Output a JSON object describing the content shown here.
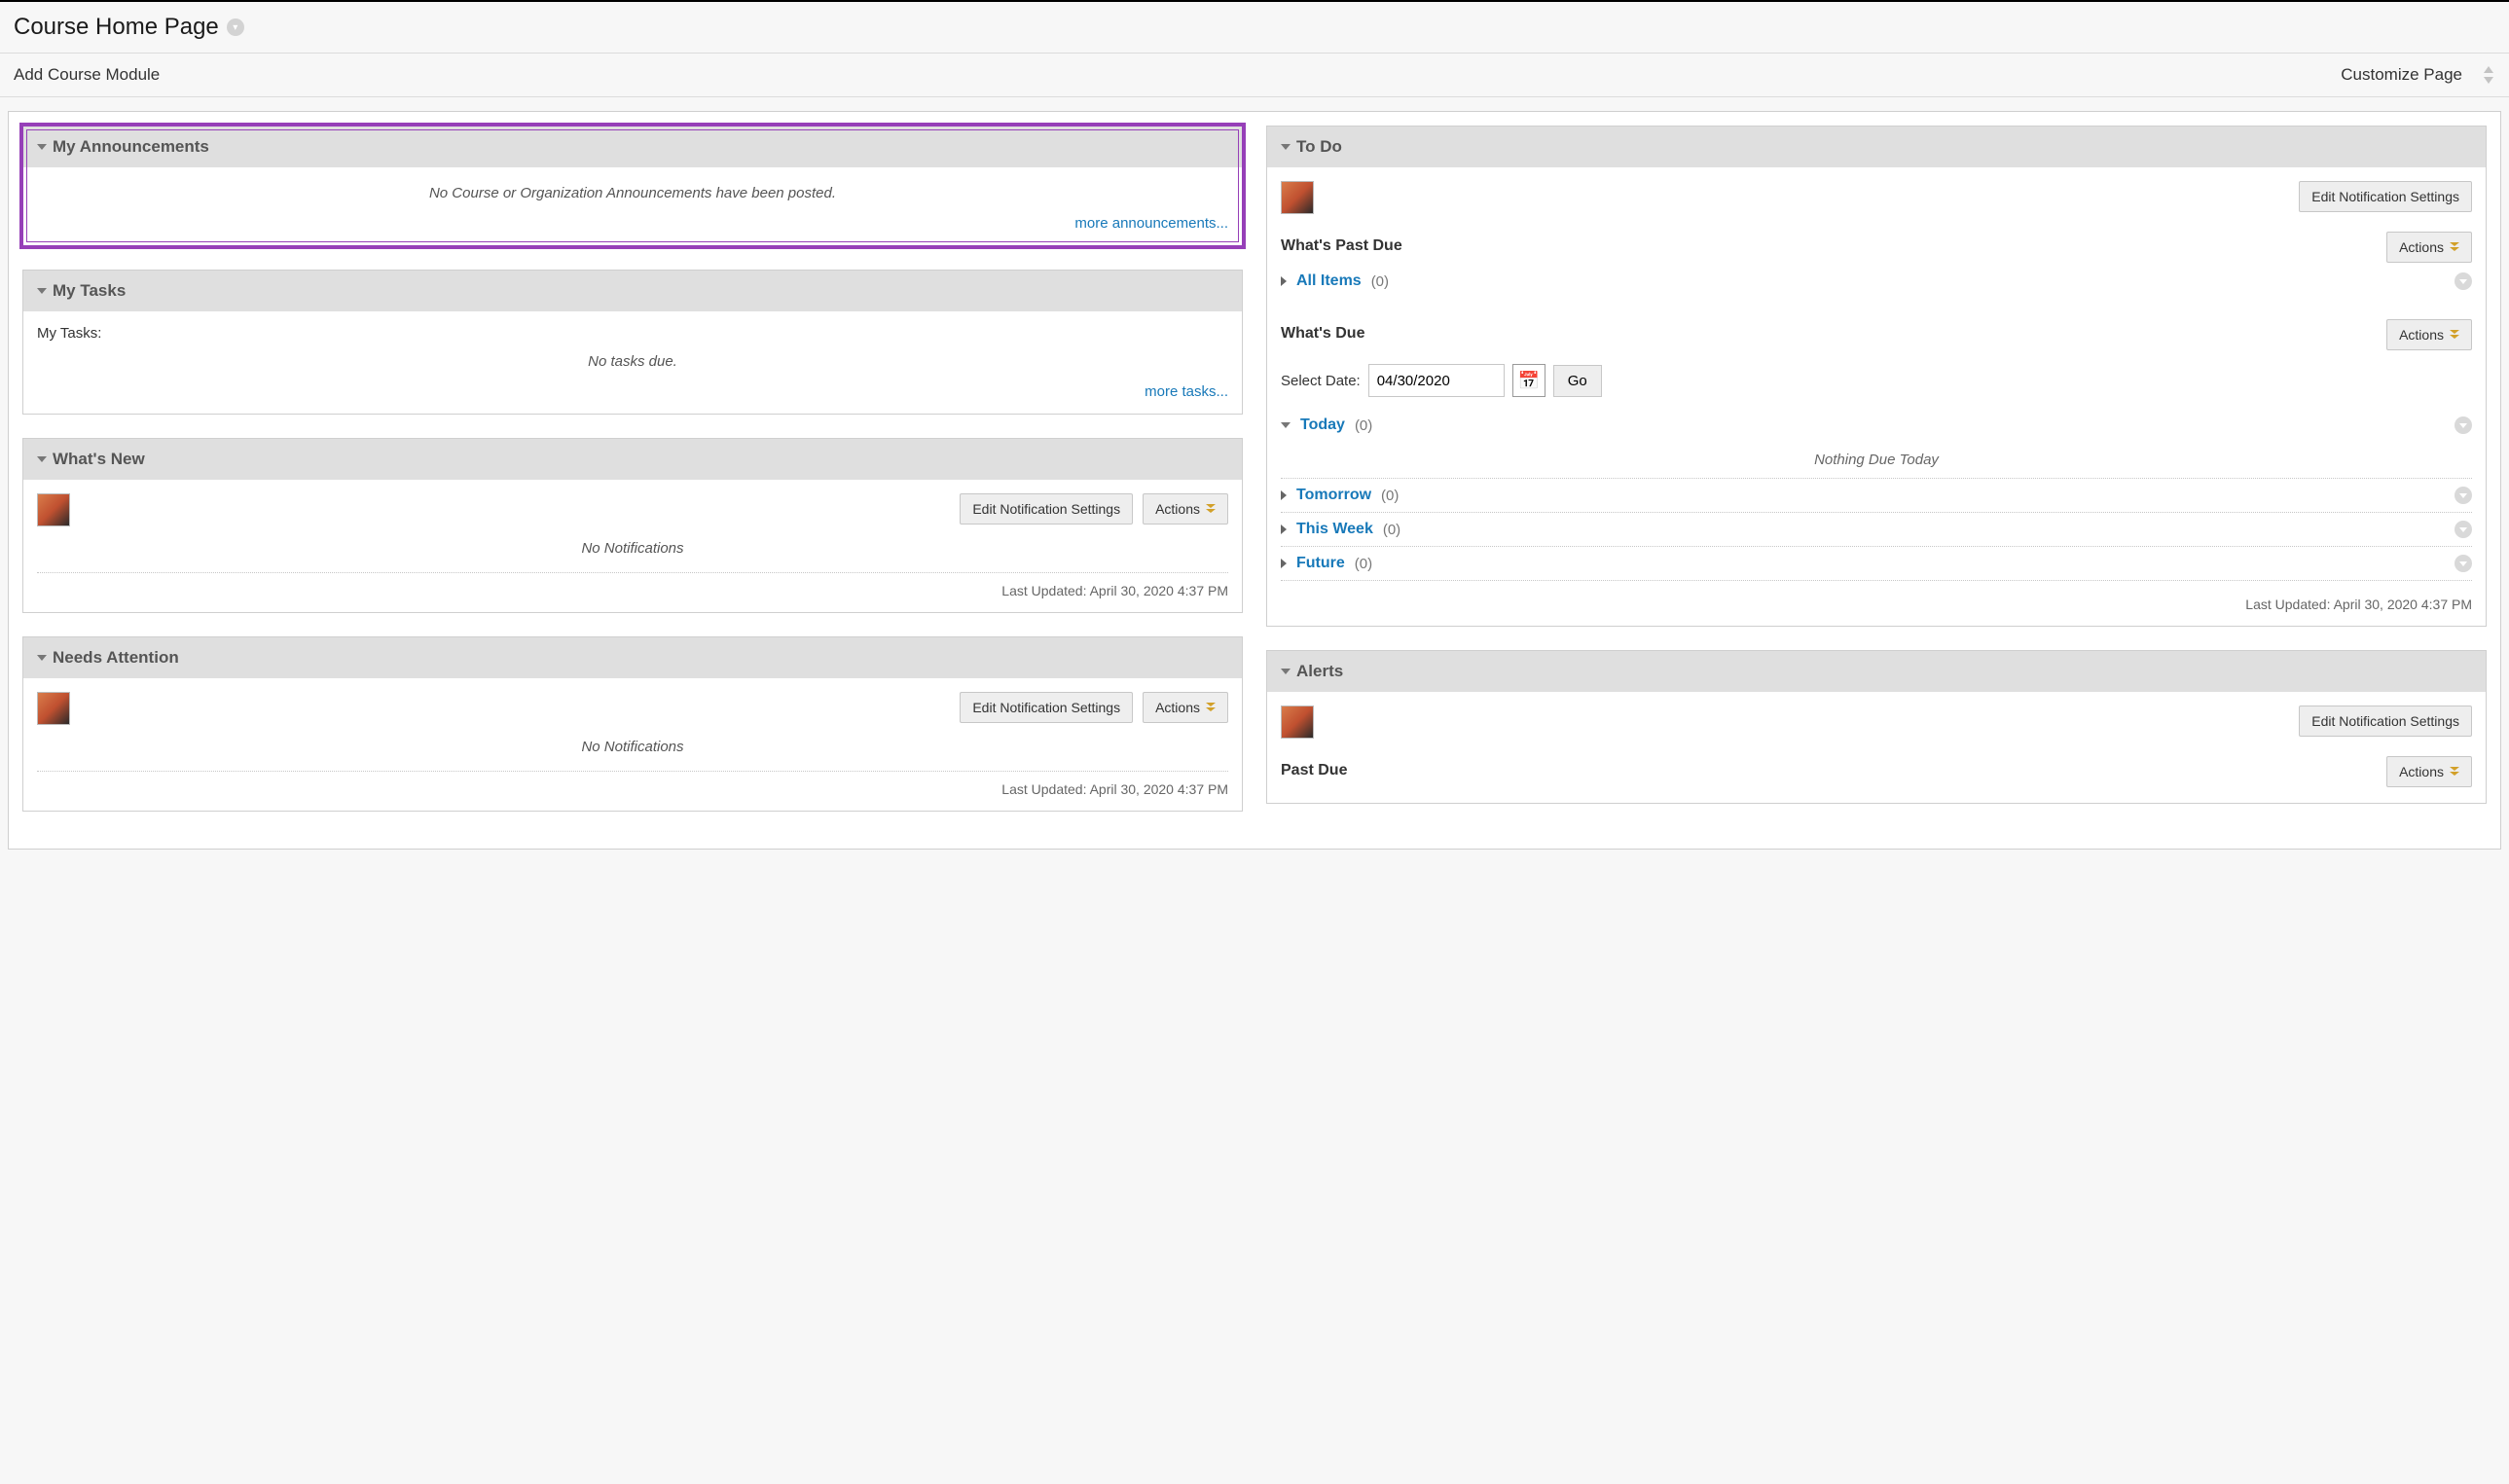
{
  "header": {
    "title": "Course Home Page"
  },
  "toolbar": {
    "add_module": "Add Course Module",
    "customize": "Customize Page"
  },
  "announcements": {
    "title": "My Announcements",
    "empty": "No Course or Organization Announcements have been posted.",
    "more": "more announcements..."
  },
  "tasks": {
    "title": "My Tasks",
    "label": "My Tasks:",
    "empty": "No tasks due.",
    "more": "more tasks..."
  },
  "whats_new": {
    "title": "What's New",
    "edit_btn": "Edit Notification Settings",
    "actions_btn": "Actions",
    "empty": "No Notifications",
    "updated": "Last Updated: April 30, 2020 4:37 PM"
  },
  "needs_attention": {
    "title": "Needs Attention",
    "edit_btn": "Edit Notification Settings",
    "actions_btn": "Actions",
    "empty": "No Notifications",
    "updated": "Last Updated: April 30, 2020 4:37 PM"
  },
  "todo": {
    "title": "To Do",
    "edit_btn": "Edit Notification Settings",
    "past_due_title": "What's Past Due",
    "actions_btn": "Actions",
    "all_items": "All Items",
    "all_items_count": "(0)",
    "whats_due_title": "What's Due",
    "select_date_label": "Select Date:",
    "date_value": "04/30/2020",
    "go_btn": "Go",
    "today": "Today",
    "today_count": "(0)",
    "nothing_today": "Nothing Due Today",
    "tomorrow": "Tomorrow",
    "tomorrow_count": "(0)",
    "this_week": "This Week",
    "this_week_count": "(0)",
    "future": "Future",
    "future_count": "(0)",
    "updated": "Last Updated: April 30, 2020 4:37 PM"
  },
  "alerts": {
    "title": "Alerts",
    "edit_btn": "Edit Notification Settings",
    "actions_btn": "Actions",
    "past_due": "Past Due"
  }
}
